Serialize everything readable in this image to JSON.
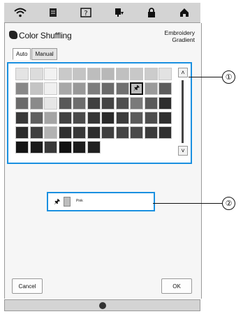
{
  "topbar": {
    "icons": [
      "wifi-icon",
      "document-icon",
      "help-icon",
      "threading-icon",
      "lock-icon",
      "home-icon"
    ]
  },
  "header": {
    "title": "Color Shuffling",
    "mode_line1": "Embroidery",
    "mode_line2": "Gradient"
  },
  "tabs": [
    {
      "label": "Auto",
      "active": true
    },
    {
      "label": "Manual",
      "active": false
    }
  ],
  "palette": {
    "rows": [
      [
        "#e4e4e4",
        "#dcdcdc",
        "#f2f2f2",
        "#c9c9c9",
        "#c4c4c4",
        "#bdbdbd",
        "#b8b8b8",
        "#c0c0c0",
        "#c8c8c8",
        "#cccccc",
        "#e2e2e2"
      ],
      [
        "#888888",
        "#c4c4c4",
        "#f0f0f0",
        "#a8a8a8",
        "#999999",
        "#7d7d7d",
        "#6a6a6a",
        "#707070",
        "#bcbcbc",
        "#9a9a9a",
        "#5c5c5c"
      ],
      [
        "#6a6a6a",
        "#8a8a8a",
        "#e6e6e6",
        "#595959",
        "#6d6d6d",
        "#3f3f3f",
        "#444444",
        "#4f4f4f",
        "#7a7a7a",
        "#5a5a5a",
        "#2d2d2d"
      ],
      [
        "#383838",
        "#5f5f5f",
        "#a4a4a4",
        "#414141",
        "#4a4a4a",
        "#363636",
        "#2a2a2a",
        "#3c3c3c",
        "#5a5a5a",
        "#4d4d4d",
        "#2f2f2f"
      ],
      [
        "#2a2a2a",
        "#3f3f3f",
        "#b2b2b2",
        "#2f2f2f",
        "#383838",
        "#2e2e2e",
        "#3f3f3f",
        "#444444",
        "#494949",
        "#3b3b3b",
        "#2f2f2f"
      ],
      [
        "#141414",
        "#1b1b1b",
        "#3a3a3a",
        "#111111",
        "#1c1c1c",
        "#202020"
      ]
    ],
    "selected": {
      "row": 1,
      "col": 8
    }
  },
  "current": {
    "name": "Pink",
    "swatch_color": "#bdbdbd"
  },
  "buttons": {
    "cancel": "Cancel",
    "ok": "OK"
  },
  "callouts": [
    "①",
    "②"
  ],
  "accent_color": "#1a90e0"
}
